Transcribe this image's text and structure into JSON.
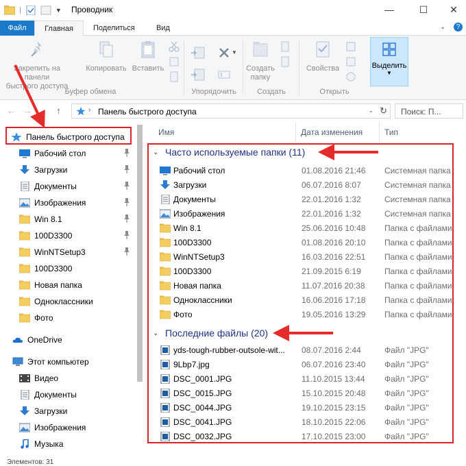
{
  "window": {
    "title": "Проводник"
  },
  "tabs": {
    "file": "Файл",
    "home": "Главная",
    "share": "Поделиться",
    "view": "Вид"
  },
  "ribbon": {
    "pin_label": "Закрепить на панели быстрого доступа",
    "pin_line1": "Закрепить на панели",
    "pin_line2": "быстрого доступа",
    "copy_label": "Копировать",
    "paste_label": "Вставить",
    "clipboard_group": "Буфер обмена",
    "organize_group": "Упорядочить",
    "new_folder_line1": "Создать",
    "new_folder_line2": "папку",
    "create_group": "Создать",
    "properties_label": "Свойства",
    "open_group": "Открыть",
    "select_label": "Выделить"
  },
  "address": {
    "path": "Панель быстрого доступа",
    "search_placeholder": "Поиск: П..."
  },
  "nav": {
    "quick_access": "Панель быстрого доступа",
    "items": [
      {
        "label": "Рабочий стол",
        "icon": "desktop-icon",
        "pinned": true
      },
      {
        "label": "Загрузки",
        "icon": "downloads-icon",
        "pinned": true
      },
      {
        "label": "Документы",
        "icon": "documents-icon",
        "pinned": true
      },
      {
        "label": "Изображения",
        "icon": "pictures-icon",
        "pinned": true
      },
      {
        "label": "Win 8.1",
        "icon": "folder-icon",
        "pinned": true
      },
      {
        "label": "100D3300",
        "icon": "folder-icon",
        "pinned": true
      },
      {
        "label": "WinNTSetup3",
        "icon": "folder-icon",
        "pinned": true
      },
      {
        "label": "100D3300",
        "icon": "folder-icon",
        "pinned": false
      },
      {
        "label": "Новая папка",
        "icon": "folder-icon",
        "pinned": false
      },
      {
        "label": "Одноклассники",
        "icon": "folder-icon",
        "pinned": false
      },
      {
        "label": "Фото",
        "icon": "folder-icon",
        "pinned": false
      }
    ],
    "onedrive": "OneDrive",
    "this_pc": "Этот компьютер",
    "pc_items": [
      {
        "label": "Видео",
        "icon": "video-icon"
      },
      {
        "label": "Документы",
        "icon": "documents-icon"
      },
      {
        "label": "Загрузки",
        "icon": "downloads-icon"
      },
      {
        "label": "Изображения",
        "icon": "pictures-icon"
      },
      {
        "label": "Музыка",
        "icon": "music-icon"
      }
    ]
  },
  "columns": {
    "name": "Имя",
    "date": "Дата изменения",
    "type": "Тип"
  },
  "groups": {
    "frequent": "Часто используемые папки (11)",
    "recent": "Последние файлы (20)"
  },
  "frequent_rows": [
    {
      "name": "Рабочий стол",
      "date": "01.08.2016 21:46",
      "type": "Системная папка",
      "icon": "desktop-icon"
    },
    {
      "name": "Загрузки",
      "date": "06.07.2016 8:07",
      "type": "Системная папка",
      "icon": "downloads-icon"
    },
    {
      "name": "Документы",
      "date": "22.01.2016 1:32",
      "type": "Системная папка",
      "icon": "documents-icon"
    },
    {
      "name": "Изображения",
      "date": "22.01.2016 1:32",
      "type": "Системная папка",
      "icon": "pictures-icon"
    },
    {
      "name": "Win 8.1",
      "date": "25.06.2016 10:48",
      "type": "Папка с файлами",
      "icon": "folder-icon"
    },
    {
      "name": "100D3300",
      "date": "01.08.2016 20:10",
      "type": "Папка с файлами",
      "icon": "folder-icon"
    },
    {
      "name": "WinNTSetup3",
      "date": "16.03.2016 22:51",
      "type": "Папка с файлами",
      "icon": "folder-icon"
    },
    {
      "name": "100D3300",
      "date": "21.09.2015 6:19",
      "type": "Папка с файлами",
      "icon": "folder-icon"
    },
    {
      "name": "Новая папка",
      "date": "11.07.2016 20:38",
      "type": "Папка с файлами",
      "icon": "folder-icon"
    },
    {
      "name": "Одноклассники",
      "date": "16.06.2016 17:18",
      "type": "Папка с файлами",
      "icon": "folder-icon"
    },
    {
      "name": "Фото",
      "date": "19.05.2016 13:29",
      "type": "Папка с файлами",
      "icon": "folder-icon"
    }
  ],
  "recent_rows": [
    {
      "name": "yds-tough-rubber-outsole-wit...",
      "date": "08.07.2016 2:44",
      "type": "Файл \"JPG\"",
      "icon": "image-file-icon"
    },
    {
      "name": "9Lbp7.jpg",
      "date": "06.07.2016 23:40",
      "type": "Файл \"JPG\"",
      "icon": "image-file-icon"
    },
    {
      "name": "DSC_0001.JPG",
      "date": "11.10.2015 13:44",
      "type": "Файл \"JPG\"",
      "icon": "image-file-icon"
    },
    {
      "name": "DSC_0015.JPG",
      "date": "15.10.2015 20:48",
      "type": "Файл \"JPG\"",
      "icon": "image-file-icon"
    },
    {
      "name": "DSC_0044.JPG",
      "date": "19.10.2015 23:15",
      "type": "Файл \"JPG\"",
      "icon": "image-file-icon"
    },
    {
      "name": "DSC_0041.JPG",
      "date": "18.10.2015 22:06",
      "type": "Файл \"JPG\"",
      "icon": "image-file-icon"
    },
    {
      "name": "DSC_0032.JPG",
      "date": "17.10.2015 23:00",
      "type": "Файл \"JPG\"",
      "icon": "image-file-icon"
    }
  ],
  "status": {
    "text": "Элементов: 31"
  },
  "colors": {
    "accent": "#1979ca",
    "highlight": "#d9232b",
    "folder": "#f4cd61",
    "group_text": "#1e3287"
  }
}
